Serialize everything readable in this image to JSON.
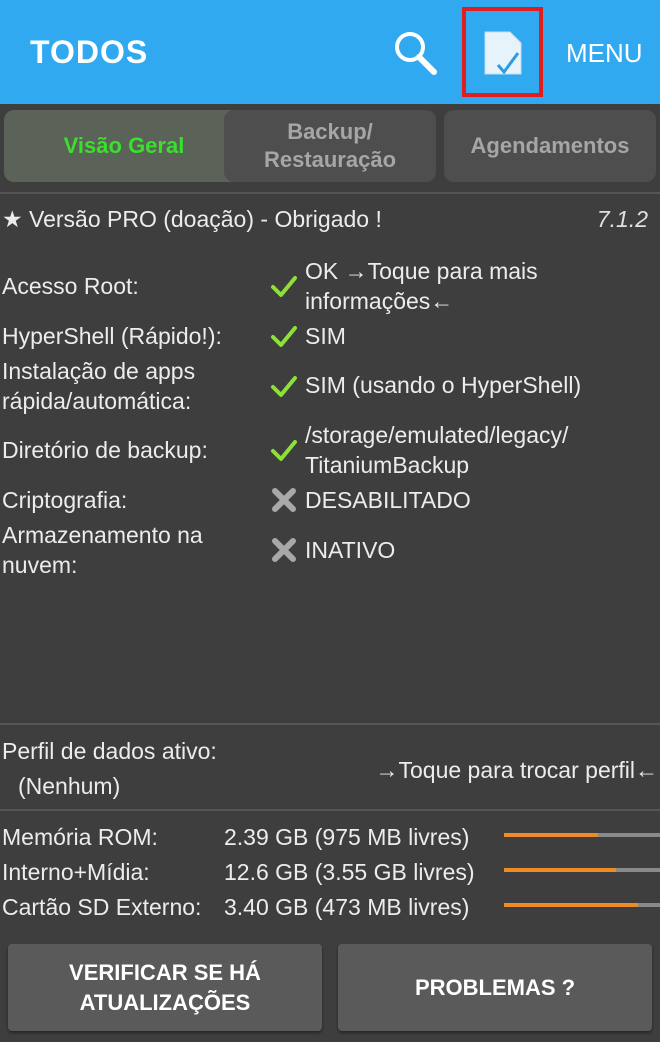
{
  "header": {
    "title": "TODOS",
    "menu_label": "MENU",
    "search_icon": "search-icon",
    "checklist_icon": "checklist-icon"
  },
  "tabs": [
    {
      "label": "Visão Geral",
      "active": true
    },
    {
      "label": "Backup/\nRestauração",
      "active": false
    },
    {
      "label": "Agendamentos",
      "active": false
    }
  ],
  "version": {
    "text": "★ Versão PRO (doação) - Obrigado !",
    "number": "7.1.2"
  },
  "status": [
    {
      "label": "Acesso Root:",
      "value": "OK →Toque para mais\ninformações←",
      "ok": true
    },
    {
      "label": "HyperShell (Rápido!):",
      "value": "SIM",
      "ok": true
    },
    {
      "label": "Instalação de apps\nrápida/automática:",
      "value": "SIM (usando o HyperShell)",
      "ok": true
    },
    {
      "label": "Diretório de backup:",
      "value": "/storage/emulated/legacy/\nTitaniumBackup",
      "ok": true
    },
    {
      "label": "Criptografia:",
      "value": "DESABILITADO",
      "ok": false
    },
    {
      "label": "Armazenamento na\nnuvem:",
      "value": "INATIVO",
      "ok": false
    }
  ],
  "profile": {
    "label": "Perfil de dados ativo:",
    "value": "(Nenhum)",
    "action": "→Toque para trocar perfil←"
  },
  "storage": [
    {
      "label": "Memória ROM:",
      "value": "2.39 GB (975 MB livres)",
      "used_fraction": 0.6
    },
    {
      "label": "Interno+Mídia:",
      "value": "12.6 GB (3.55 GB livres)",
      "used_fraction": 0.72
    },
    {
      "label": "Cartão SD Externo:",
      "value": "3.40 GB (473 MB livres)",
      "used_fraction": 0.86
    }
  ],
  "buttons": {
    "check_updates": "VERIFICAR SE HÁ\nATUALIZAÇÕES",
    "problems": "PROBLEMAS ?"
  },
  "colors": {
    "header_bg": "#30a9f1",
    "ok_check": "#8ee03a",
    "active_tab_text": "#39e02c",
    "bar_fill": "#f08a26"
  }
}
